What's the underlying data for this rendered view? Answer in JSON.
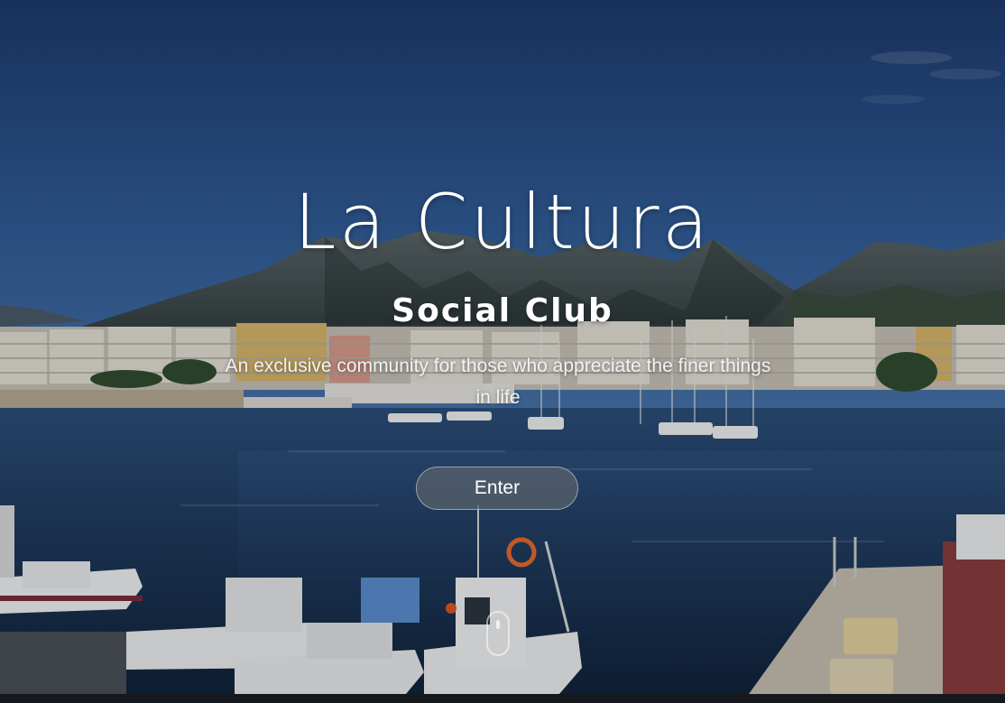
{
  "hero": {
    "title": "La Cultura",
    "subtitle": "Social Club",
    "tagline": "An exclusive community for those who appreciate the finer things in life",
    "cta_label": "Enter",
    "background": "harbor-mountain-photo"
  },
  "colors": {
    "sky_top": "#1f3d75",
    "sky_bottom": "#3f6aa3",
    "mountain": "#3e4a4c",
    "sea": "#1d3555",
    "button_bg": "#5a626c",
    "text": "#ffffff"
  },
  "icons": {
    "scroll": "mouse-scroll-icon"
  }
}
